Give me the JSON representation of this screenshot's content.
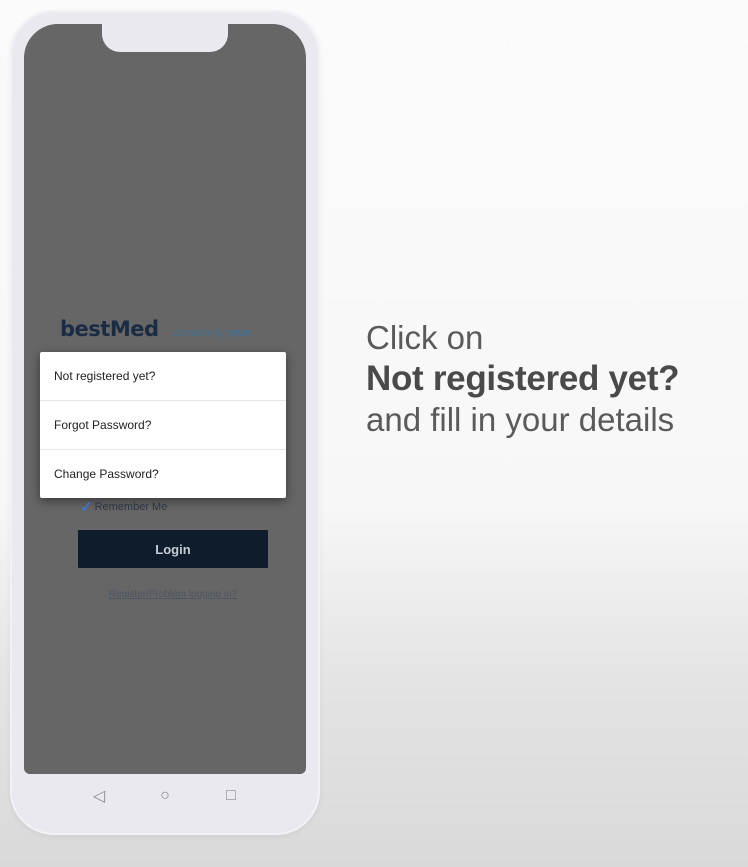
{
  "app": {
    "brand_name": "bestMed",
    "brand_tagline": "personally yours"
  },
  "popup_menu": {
    "items": [
      {
        "label": "Not registered yet?"
      },
      {
        "label": "Forgot Password?"
      },
      {
        "label": "Change Password?"
      }
    ]
  },
  "login_form": {
    "remember_me_label": "Remember Me",
    "remember_me_checked": true,
    "login_button_label": "Login",
    "register_link_label": "Register/Problem logging in?"
  },
  "navbar": {
    "back_icon": "◁",
    "home_icon": "○",
    "recents_icon": "□"
  },
  "instruction": {
    "line1": "Click on",
    "line2": "Not registered yet?",
    "line3": "and fill in your details"
  },
  "colors": {
    "screen_bg": "#666666",
    "login_button": "#0f1c2b",
    "brand_name": "#1a2b44",
    "brand_tagline": "#3e6f92",
    "checkmark": "#3a77c9"
  }
}
